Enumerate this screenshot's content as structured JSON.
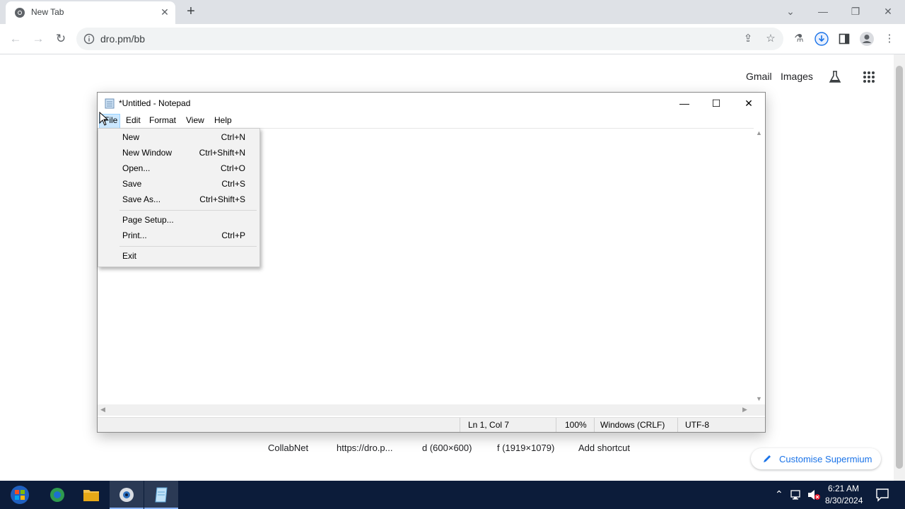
{
  "browser": {
    "tab_title": "New Tab",
    "tab_close": "✕",
    "new_tab": "+",
    "url": "dro.pm/bb",
    "window_controls": {
      "dropdown": "⌄",
      "minimize": "—",
      "restore": "❐",
      "close": "✕"
    }
  },
  "ntp": {
    "gmail": "Gmail",
    "images": "Images",
    "shortcuts": [
      "CollabNet",
      "https://dro.p...",
      "d (600×600)",
      "f (1919×1079)",
      "Add shortcut"
    ],
    "customise": "Customise Supermium"
  },
  "notepad": {
    "title": "*Untitled - Notepad",
    "menu": [
      "File",
      "Edit",
      "Format",
      "View",
      "Help"
    ],
    "status": {
      "position": "Ln 1, Col 7",
      "zoom": "100%",
      "line_ending": "Windows (CRLF)",
      "encoding": "UTF-8"
    }
  },
  "file_menu": {
    "items": [
      {
        "label": "New",
        "shortcut": "Ctrl+N"
      },
      {
        "label": "New Window",
        "shortcut": "Ctrl+Shift+N"
      },
      {
        "label": "Open...",
        "shortcut": "Ctrl+O"
      },
      {
        "label": "Save",
        "shortcut": "Ctrl+S"
      },
      {
        "label": "Save As...",
        "shortcut": "Ctrl+Shift+S"
      },
      {
        "label": "Page Setup...",
        "shortcut": ""
      },
      {
        "label": "Print...",
        "shortcut": "Ctrl+P"
      },
      {
        "label": "Exit",
        "shortcut": ""
      }
    ]
  },
  "taskbar": {
    "time": "6:21 AM",
    "date": "8/30/2024"
  },
  "colors": {
    "accent": "#1a73e8",
    "taskbar": "#0c1c3a",
    "menu_bg": "#f2f2f2"
  }
}
